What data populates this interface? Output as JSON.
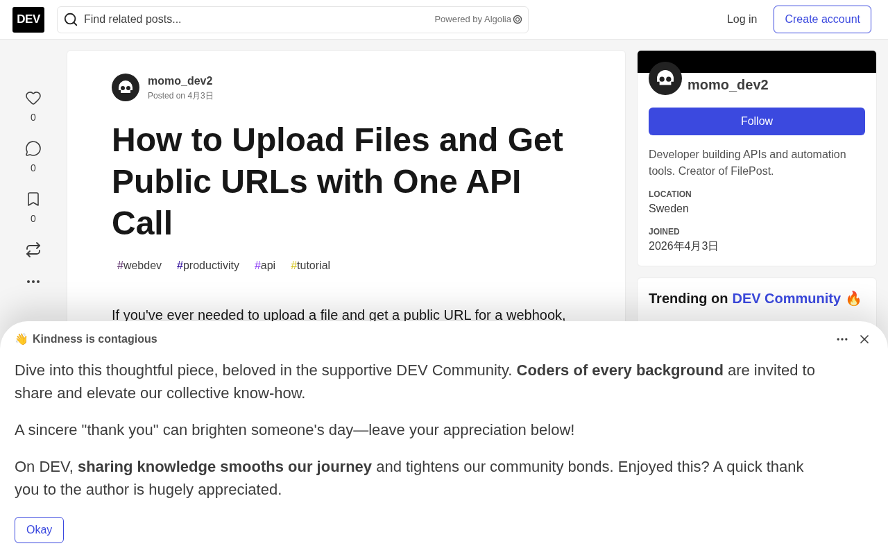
{
  "header": {
    "logo": "DEV",
    "search": {
      "placeholder": "Find related posts...",
      "powered_by": "Powered by Algolia"
    },
    "login": "Log in",
    "create_account": "Create account"
  },
  "reactions": [
    {
      "kind": "heart",
      "count": "0"
    },
    {
      "kind": "comment",
      "count": "0"
    },
    {
      "kind": "bookmark",
      "count": "0"
    },
    {
      "kind": "share"
    },
    {
      "kind": "more"
    }
  ],
  "article": {
    "author": "momo_dev2",
    "posted": "Posted on 4月3日",
    "title": "How to Upload Files and Get Public URLs with One API Call",
    "tags": [
      {
        "hash": "#",
        "name": "webdev",
        "color": "#562765"
      },
      {
        "hash": "#",
        "name": "productivity",
        "color": "#2a0798"
      },
      {
        "hash": "#",
        "name": "api",
        "color": "#8d3ff5"
      },
      {
        "hash": "#",
        "name": "tutorial",
        "color": "#d6c51f"
      }
    ],
    "body": [
      "If you've ever needed to upload a file and get a public URL for a webhook,"
    ]
  },
  "profile": {
    "name": "momo_dev2",
    "follow": "Follow",
    "bio": "Developer building APIs and automation tools. Creator of FilePost.",
    "fields": [
      {
        "label": "LOCATION",
        "value": "Sweden"
      },
      {
        "label": "JOINED",
        "value": "2026年4月3日"
      }
    ]
  },
  "trending": {
    "prefix": "Trending on",
    "link": "DEV Community",
    "emoji": "🔥"
  },
  "modal": {
    "emoji": "👋",
    "title": "Kindness is contagious",
    "paragraphs": [
      "Dive into this thoughtful piece, beloved in the supportive DEV Community. **Coders of every background** are invited to share and elevate our collective know-how.",
      "A sincere \"thank you\" can brighten someone's day—leave your appreciation below!",
      "On DEV, **sharing knowledge smooths our journey** and tightens our community bonds. Enjoyed this? A quick thank you to the author is hugely appreciated."
    ],
    "button": "Okay"
  }
}
